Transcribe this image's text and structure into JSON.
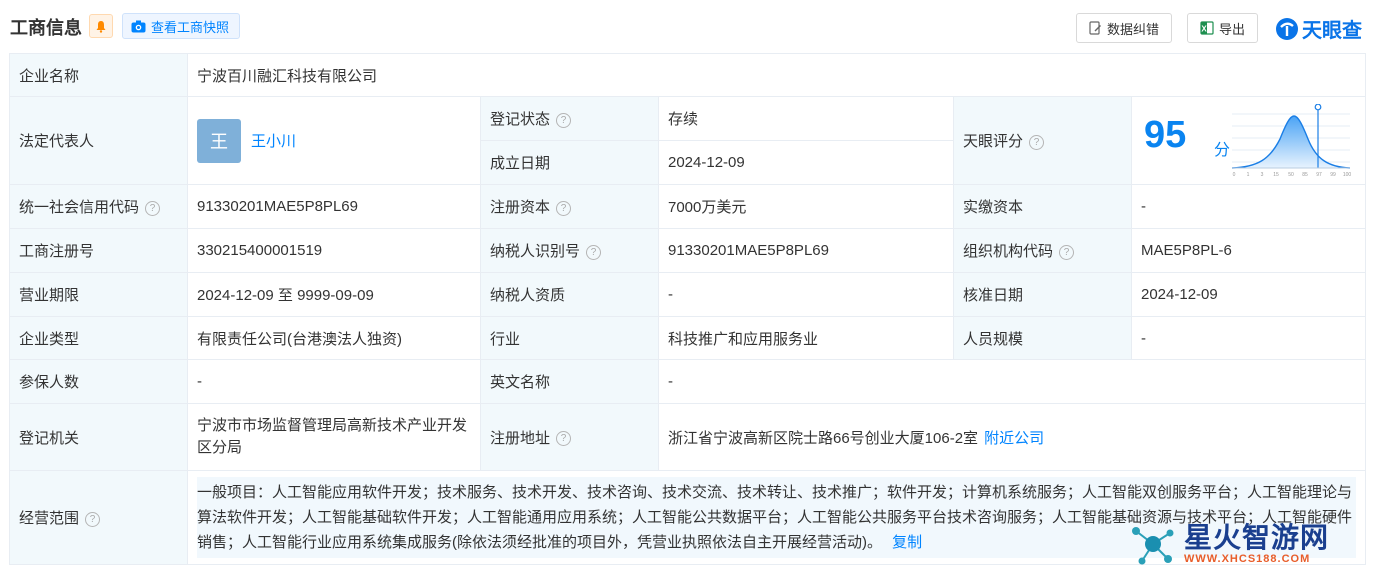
{
  "header": {
    "title": "工商信息",
    "snapshot_label": "查看工商快照",
    "correct_label": "数据纠错",
    "export_label": "导出",
    "logo_text": "天眼查"
  },
  "table": {
    "company_name": {
      "label": "企业名称",
      "value": "宁波百川融汇科技有限公司"
    },
    "legal_rep": {
      "label": "法定代表人",
      "avatar": "王",
      "value": "王小川"
    },
    "reg_status": {
      "label": "登记状态",
      "value": "存续"
    },
    "established": {
      "label": "成立日期",
      "value": "2024-12-09"
    },
    "tianyan_score": {
      "label": "天眼评分",
      "value": "95",
      "unit": "分"
    },
    "credit_code": {
      "label": "统一社会信用代码",
      "value": "91330201MAE5P8PL69"
    },
    "reg_capital": {
      "label": "注册资本",
      "value": "7000万美元"
    },
    "paid_capital": {
      "label": "实缴资本",
      "value": "-"
    },
    "biz_reg_no": {
      "label": "工商注册号",
      "value": "330215400001519"
    },
    "taxpayer_id": {
      "label": "纳税人识别号",
      "value": "91330201MAE5P8PL69"
    },
    "org_code": {
      "label": "组织机构代码",
      "value": "MAE5P8PL-6"
    },
    "biz_term": {
      "label": "营业期限",
      "value": "2024-12-09 至 9999-09-09"
    },
    "taxpayer_qual": {
      "label": "纳税人资质",
      "value": "-"
    },
    "approval_date": {
      "label": "核准日期",
      "value": "2024-12-09"
    },
    "company_type": {
      "label": "企业类型",
      "value": "有限责任公司(台港澳法人独资)"
    },
    "industry": {
      "label": "行业",
      "value": "科技推广和应用服务业"
    },
    "staff_size": {
      "label": "人员规模",
      "value": "-"
    },
    "insured": {
      "label": "参保人数",
      "value": "-"
    },
    "english_name": {
      "label": "英文名称",
      "value": "-"
    },
    "reg_authority": {
      "label": "登记机关",
      "value": "宁波市市场监督管理局高新技术产业开发区分局"
    },
    "reg_address": {
      "label": "注册地址",
      "value": "浙江省宁波高新区院士路66号创业大厦106-2室",
      "nearby": "附近公司"
    },
    "biz_scope": {
      "label": "经营范围",
      "value": "一般项目：人工智能应用软件开发；技术服务、技术开发、技术咨询、技术交流、技术转让、技术推广；软件开发；计算机系统服务；人工智能双创服务平台；人工智能理论与算法软件开发；人工智能基础软件开发；人工智能通用应用系统；人工智能公共数据平台；人工智能公共服务平台技术咨询服务；人工智能基础资源与技术平台；人工智能硬件销售；人工智能行业应用系统集成服务(除依法须经批准的项目外，凭营业执照依法自主开展经营活动)。",
      "copy": "复制"
    }
  },
  "score_ticks": [
    "0",
    "1",
    "3",
    "15",
    "50",
    "85",
    "97",
    "99",
    "100"
  ],
  "watermark": {
    "main": "星火智游网",
    "sub": "WWW.XHCS188.COM"
  },
  "colors": {
    "accent": "#0084ff",
    "status": "#17a35d",
    "label_bg": "#f2f9fc"
  }
}
